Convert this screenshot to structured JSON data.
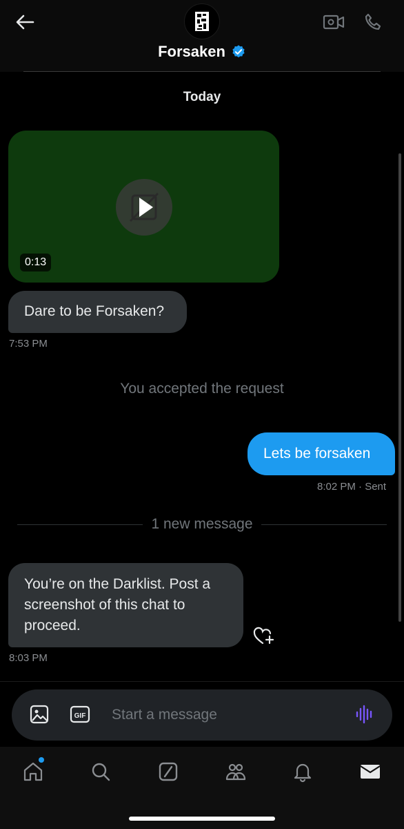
{
  "header": {
    "title": "Forsaken",
    "verified": true,
    "icons": [
      "back-arrow-icon",
      "avatar",
      "verified-badge-icon",
      "video-call-icon",
      "phone-icon"
    ]
  },
  "conversation": {
    "date_separator": "Today",
    "video": {
      "duration": "0:13",
      "thumb_color": "#0e3a0d"
    },
    "messages": [
      {
        "from": "them",
        "text": "Dare to be Forsaken?",
        "time": "7:53 PM"
      },
      {
        "from": "system",
        "text": "You accepted the request"
      },
      {
        "from": "me",
        "text": "Lets be forsaken",
        "time": "8:02 PM",
        "status": "· Sent"
      },
      {
        "from": "divider",
        "text": "1 new message"
      },
      {
        "from": "them",
        "text": "You’re on the Darklist. Post a screenshot of this chat to proceed.",
        "time": "8:03 PM"
      }
    ]
  },
  "composer": {
    "placeholder": "Start a message",
    "image_icon": "image-icon",
    "gif_label": "GIF",
    "voice_icon": "voice-waveform-icon"
  },
  "nav": {
    "items": [
      "home-icon",
      "search-icon",
      "grok-icon",
      "communities-icon",
      "notifications-icon",
      "messages-icon"
    ],
    "home_has_dot": true
  },
  "colors": {
    "accent": "#1d9bf0",
    "bubble_in": "#2f3336",
    "voice": "#7856ff"
  }
}
